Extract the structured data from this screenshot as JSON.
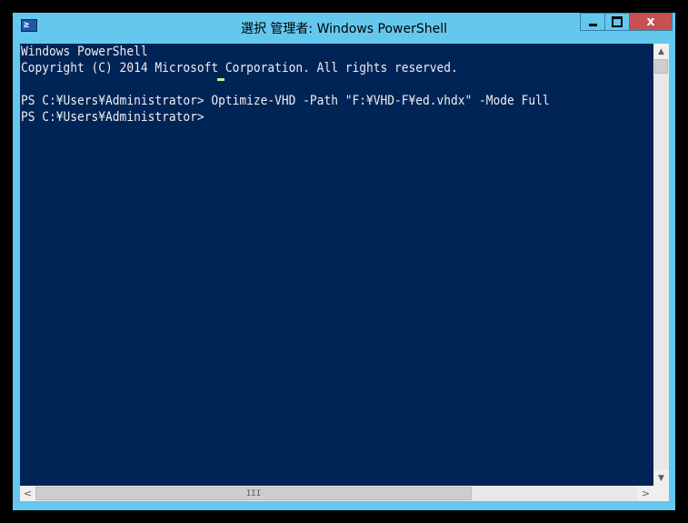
{
  "window": {
    "title": "選択 管理者: Windows PowerShell",
    "app_icon": "powershell-icon",
    "app_icon_glyph": "≥",
    "close_glyph": "x",
    "frame_color": "#64c8ee",
    "console_background": "#012456",
    "console_text_color": "#eeedf0",
    "cursor_color": "#c8f08c"
  },
  "console": {
    "lines": [
      "Windows PowerShell",
      "Copyright (C) 2014 Microsoft Corporation. All rights reserved.",
      "",
      "PS C:¥Users¥Administrator> Optimize-VHD -Path \"F:¥VHD-F¥ed.vhdx\" -Mode Full",
      "PS C:¥Users¥Administrator> "
    ]
  },
  "scrollbars": {
    "up_arrow": "▲",
    "down_arrow": "▼",
    "left_arrow": "<",
    "right_arrow": ">",
    "h_thumb_grip": "III"
  }
}
